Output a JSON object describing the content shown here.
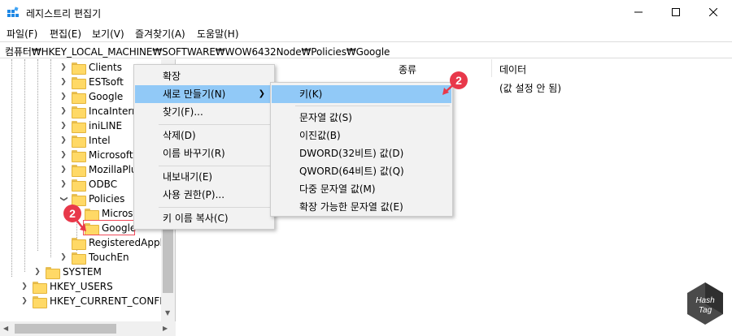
{
  "window": {
    "title": "레지스트리 편집기"
  },
  "menubar": [
    "파일(F)",
    "편집(E)",
    "보기(V)",
    "즐겨찾기(A)",
    "도움말(H)"
  ],
  "address": "컴퓨터₩HKEY_LOCAL_MACHINE₩SOFTWARE₩WOW6432Node₩Policies₩Google",
  "tree": {
    "items": [
      {
        "label": "Clients"
      },
      {
        "label": "ESTsoft"
      },
      {
        "label": "Google"
      },
      {
        "label": "IncaInterne"
      },
      {
        "label": "iniLINE"
      },
      {
        "label": "Intel"
      },
      {
        "label": "Microsoft"
      },
      {
        "label": "MozillaPlu"
      },
      {
        "label": "ODBC"
      },
      {
        "label": "Policies"
      },
      {
        "label": "Microso"
      },
      {
        "label": "Google"
      },
      {
        "label": "RegisteredApplica"
      },
      {
        "label": "TouchEn"
      },
      {
        "label": "SYSTEM"
      },
      {
        "label": "HKEY_USERS"
      },
      {
        "label": "HKEY_CURRENT_CONFIG"
      }
    ]
  },
  "right_pane": {
    "columns": [
      "종류",
      "데이터"
    ],
    "data_value": "(값 설정 안 됨)"
  },
  "context_menu": {
    "items": [
      "확장",
      "새로 만들기(N)",
      "찾기(F)...",
      "삭제(D)",
      "이름 바꾸기(R)",
      "내보내기(E)",
      "사용 권한(P)...",
      "키 이름 복사(C)"
    ]
  },
  "submenu": {
    "items": [
      "키(K)",
      "문자열 값(S)",
      "이진값(B)",
      "DWORD(32비트) 값(D)",
      "QWORD(64비트) 값(Q)",
      "다중 문자열 값(M)",
      "확장 가능한 문자열 값(E)"
    ]
  },
  "callouts": {
    "badge1": "2",
    "badge2": "2"
  },
  "watermark": {
    "line1": "Hash",
    "line2": "Tag"
  },
  "colors": {
    "highlight": "#91c9f7",
    "callout": "#e8384a",
    "folder": "#ffd966"
  }
}
